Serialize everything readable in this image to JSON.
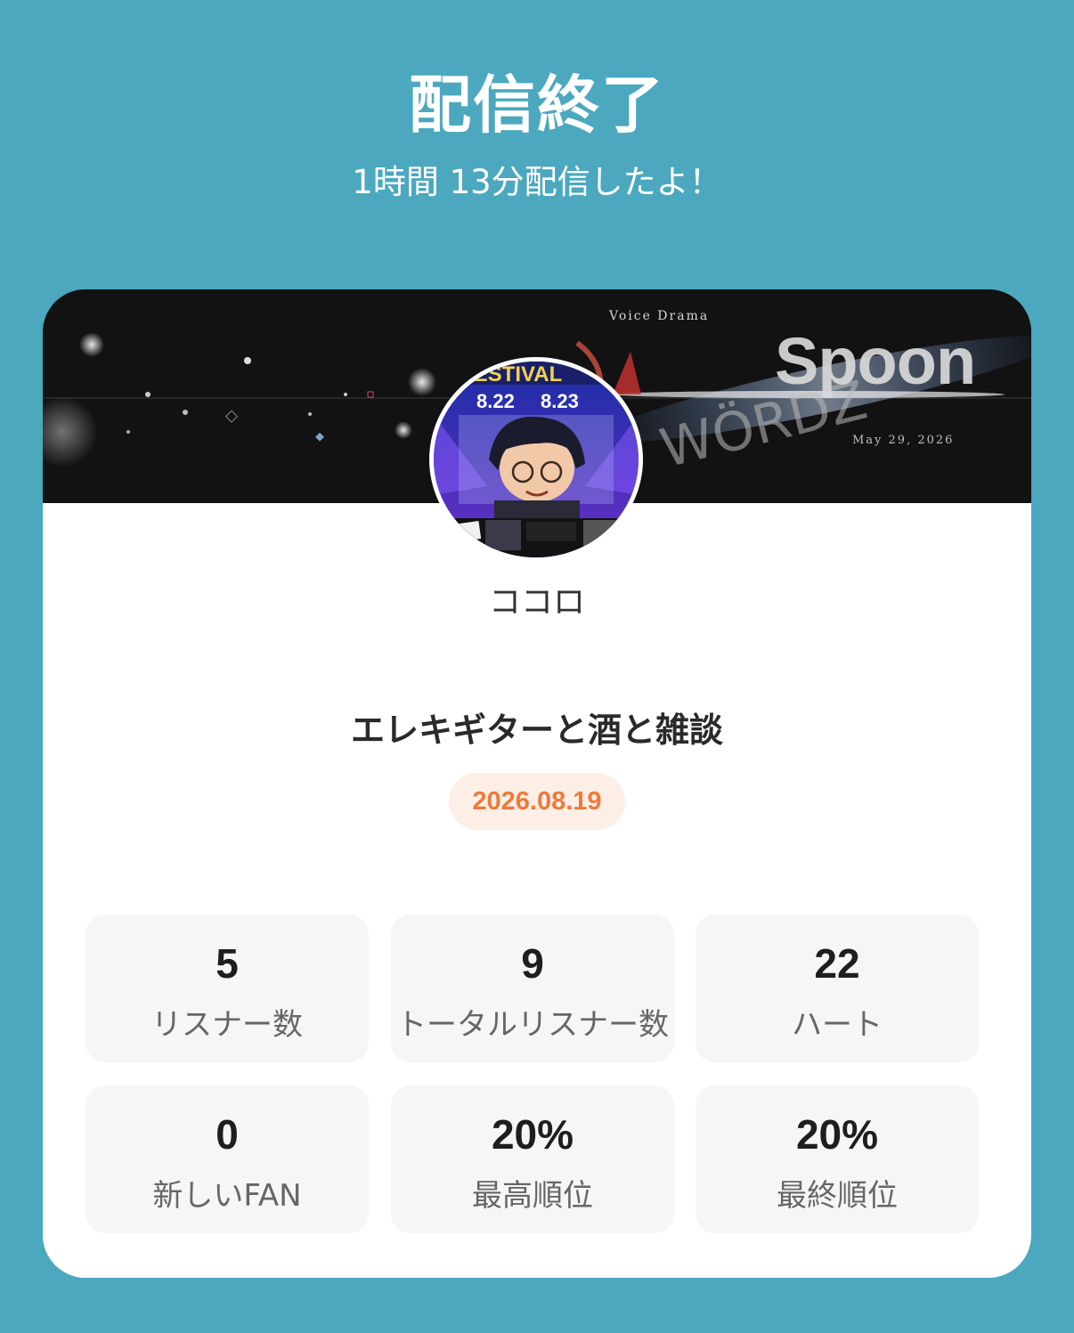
{
  "header": {
    "title": "配信終了",
    "subtitle": "1時間 13分配信したよ！"
  },
  "banner": {
    "small_title": "Voice Drama",
    "brand": "Spoon",
    "date": "May 29, 2026"
  },
  "avatar": {
    "festival_text": "FESTIVAL",
    "date1": "8.22",
    "date2": "8.23"
  },
  "profile": {
    "username": "ココロ"
  },
  "stream": {
    "title": "エレキギターと酒と雑談",
    "date": "2026.08.19"
  },
  "stats": [
    {
      "value": "5",
      "label": "リスナー数"
    },
    {
      "value": "9",
      "label": "トータルリスナー数"
    },
    {
      "value": "22",
      "label": "ハート"
    },
    {
      "value": "0",
      "label": "新しいFAN"
    },
    {
      "value": "20%",
      "label": "最高順位"
    },
    {
      "value": "20%",
      "label": "最終順位"
    }
  ],
  "colors": {
    "background": "#4ba8bf",
    "date_accent": "#ee7a3a",
    "date_pill_bg": "#fdeee6"
  }
}
